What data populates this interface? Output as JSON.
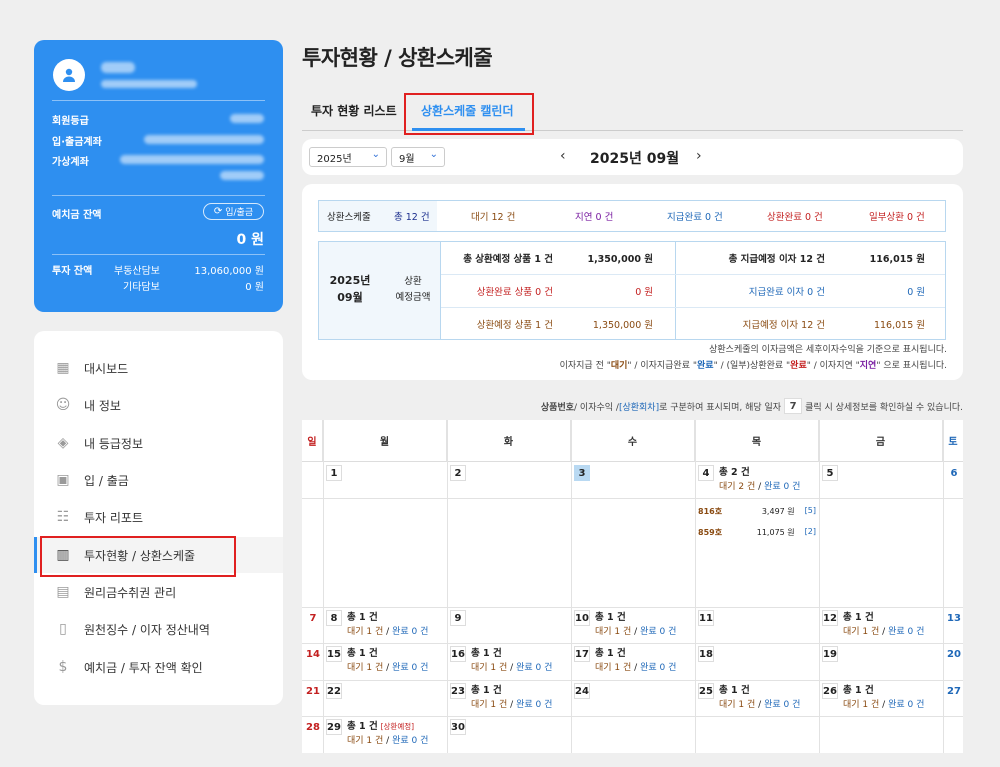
{
  "profile": {
    "member_grade_label": "회원등급",
    "account_label": "입·출금계좌",
    "virtual_account_label": "가상계좌",
    "deposit_balance_label": "예치금 잔액",
    "deposit_button": "입/출금",
    "deposit_balance_value": "0 원",
    "investment_balance_label": "투자 잔액",
    "real_estate_label": "부동산담보",
    "real_estate_value": "13,060,000 원",
    "other_label": "기타담보",
    "other_value": "0 원"
  },
  "menu": [
    {
      "label": "대시보드",
      "icon": "dashboard-icon"
    },
    {
      "label": "내 정보",
      "icon": "user-icon"
    },
    {
      "label": "내 등급정보",
      "icon": "grade-icon"
    },
    {
      "label": "입 / 출금",
      "icon": "money-icon"
    },
    {
      "label": "투자 리포트",
      "icon": "report-icon"
    },
    {
      "label": "투자현황 / 상환스케줄",
      "icon": "chart-icon"
    },
    {
      "label": "원리금수취권 관리",
      "icon": "document-icon"
    },
    {
      "label": "원천징수 / 이자 정산내역",
      "icon": "receipt-icon"
    },
    {
      "label": "예치금 / 투자 잔액 확인",
      "icon": "dollar-icon"
    }
  ],
  "page_title": "투자현황 / 상환스케줄",
  "tabs": [
    "투자 현황 리스트",
    "상환스케줄 캘린더"
  ],
  "selectors": {
    "year": "2025년",
    "month": "9월"
  },
  "nav_title": "2025년 09월",
  "summary_row": {
    "label": "상환스케줄",
    "total": "총 12 건",
    "waiting": "대기 12 건",
    "delayed": "지연 0 건",
    "paid": "지급완료 0 건",
    "repaid": "상환완료 0 건",
    "partial": "일부상환 0 건"
  },
  "monthly": {
    "month": "2025년\n09월",
    "type": "상환\n예정금액",
    "left": [
      {
        "label": "총 상환예정 상품 1 건",
        "value": "1,350,000 원"
      },
      {
        "label": "상환완료 상품 0 건",
        "value": "0 원"
      },
      {
        "label": "상환예정 상품 1 건",
        "value": "1,350,000 원"
      }
    ],
    "right": [
      {
        "label": "총 지급예정 이자 12 건",
        "value": "116,015 원"
      },
      {
        "label": "지급완료 이자 0 건",
        "value": "0 원"
      },
      {
        "label": "지급예정 이자 12 건",
        "value": "116,015 원"
      }
    ]
  },
  "notes": {
    "line1": "상환스케줄의 이자금액은 세후이자수익을 기준으로 표시됩니다.",
    "line2_parts": [
      "이자지급 전 \"",
      "대기",
      "\" / 이자지급완료 \"",
      "완료",
      "\" / (일부)상환완료 \"",
      "완료",
      "\" / 이자지연 \"",
      "지연",
      "\" 으로 표시됩니다."
    ]
  },
  "hint": {
    "bold": "상품번호",
    "mid": " / 이자수익 / ",
    "bracket": "[상환회차]",
    "rest": " 로 구분하여 표시되며, 해당 일자 ",
    "box": "7",
    "end": " 클릭 시 상세정보를 확인하실 수 있습니다."
  },
  "weekdays": [
    "일",
    "월",
    "화",
    "수",
    "목",
    "금",
    "토"
  ],
  "day_detail": [
    {
      "id": "816호",
      "amount": "3,497 원",
      "round": "[5]"
    },
    {
      "id": "859호",
      "amount": "11,075 원",
      "round": "[2]"
    }
  ],
  "status_labels": {
    "waiting": "대기",
    "done": "완료"
  },
  "colors": {
    "brand": "#2e8ff0",
    "highlight": "#e02020"
  }
}
